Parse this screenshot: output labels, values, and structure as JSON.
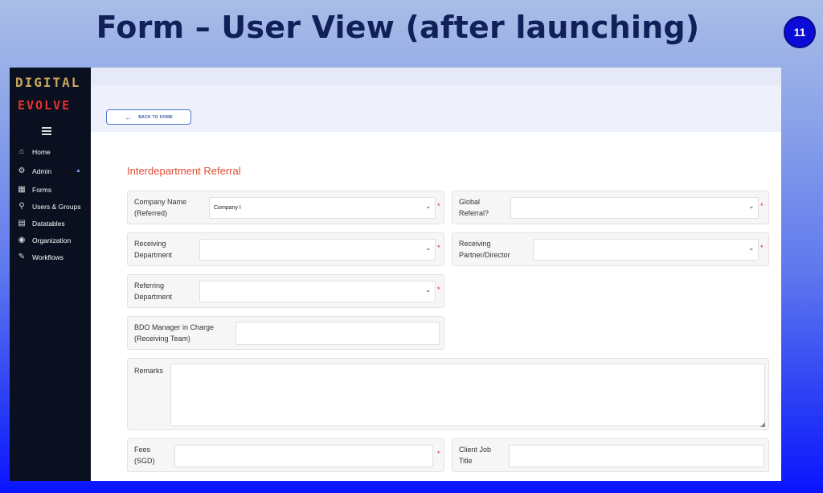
{
  "slide": {
    "title": "Form – User View (after launching)",
    "number": "11"
  },
  "sidebar": {
    "logo_line1": "DIGITAL",
    "logo_line2": "EVOLVE",
    "items": [
      {
        "label": "Home",
        "icon": "home-icon"
      },
      {
        "label": "Admin",
        "icon": "gear-icon"
      },
      {
        "label": "Forms",
        "icon": "grid-icon"
      },
      {
        "label": "Users & Groups",
        "icon": "user-icon"
      },
      {
        "label": "Datatables",
        "icon": "table-icon"
      },
      {
        "label": "Organization",
        "icon": "eye-icon"
      },
      {
        "label": "Workflows",
        "icon": "pencil-icon"
      }
    ]
  },
  "header": {
    "back_label": "BACK TO HOME"
  },
  "form": {
    "title": "Interdepartment Referral",
    "fields": {
      "company_name": {
        "label_1": "Company Name",
        "label_2": "(Referred)",
        "value": "Company I"
      },
      "global_referral": {
        "label_1": "Global",
        "label_2": "Referral?",
        "value": ""
      },
      "receiving_department": {
        "label_1": "Receiving",
        "label_2": "Department",
        "value": ""
      },
      "receiving_partner": {
        "label_1": "Receiving",
        "label_2": "Partner/Director",
        "value": ""
      },
      "referring_department": {
        "label_1": "Referring",
        "label_2": "Department",
        "value": ""
      },
      "bdo_manager": {
        "label_1": "BDO Manager in Charge",
        "label_2": "(Receiving Team)",
        "value": ""
      },
      "remarks": {
        "label": "Remarks",
        "value": ""
      },
      "fees": {
        "label_1": "Fees",
        "label_2": "(SGD)",
        "value": ""
      },
      "client_job_title": {
        "label_1": "Client Job",
        "label_2": "Title",
        "value": ""
      }
    },
    "required_mark": "*"
  },
  "colors": {
    "accent": "#e14b2f",
    "sidebar_bg": "#0b1020",
    "link": "#3b5aa8"
  }
}
